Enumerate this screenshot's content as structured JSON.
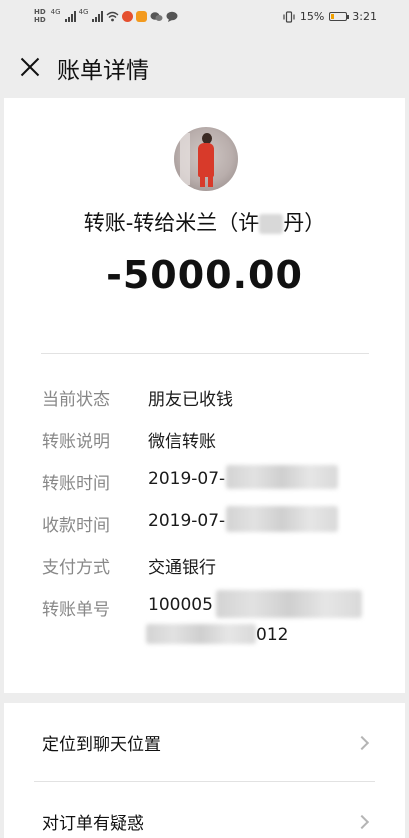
{
  "status_bar": {
    "hd_top": "HD",
    "hd_bottom": "HD",
    "net_1": "4G",
    "net_2": "4G",
    "battery_percent": "15%",
    "time": "3:21",
    "icons": [
      "signal-icon",
      "signal-icon",
      "wifi-icon",
      "app-icon",
      "video-icon",
      "wechat-icon",
      "message-icon",
      "vibrate-icon",
      "battery-icon"
    ]
  },
  "header": {
    "title": "账单详情"
  },
  "bill": {
    "payee": "转账-转给米兰（许",
    "payee_suffix": "丹）",
    "amount": "-5000.00",
    "details": [
      {
        "label": "当前状态",
        "value": "朋友已收钱"
      },
      {
        "label": "转账说明",
        "value": "微信转账"
      },
      {
        "label": "转账时间",
        "value": "2019-07-"
      },
      {
        "label": "收款时间",
        "value": "2019-07-"
      },
      {
        "label": "支付方式",
        "value": "交通银行"
      },
      {
        "label": "转账单号",
        "value": "100005",
        "value_line2": "012"
      }
    ]
  },
  "actions": [
    {
      "label": "定位到聊天位置"
    },
    {
      "label": "对订单有疑惑"
    }
  ],
  "colors": {
    "background": "#ededed",
    "card": "#ffffff",
    "label_gray": "#888888",
    "text": "#1a1a1a"
  }
}
